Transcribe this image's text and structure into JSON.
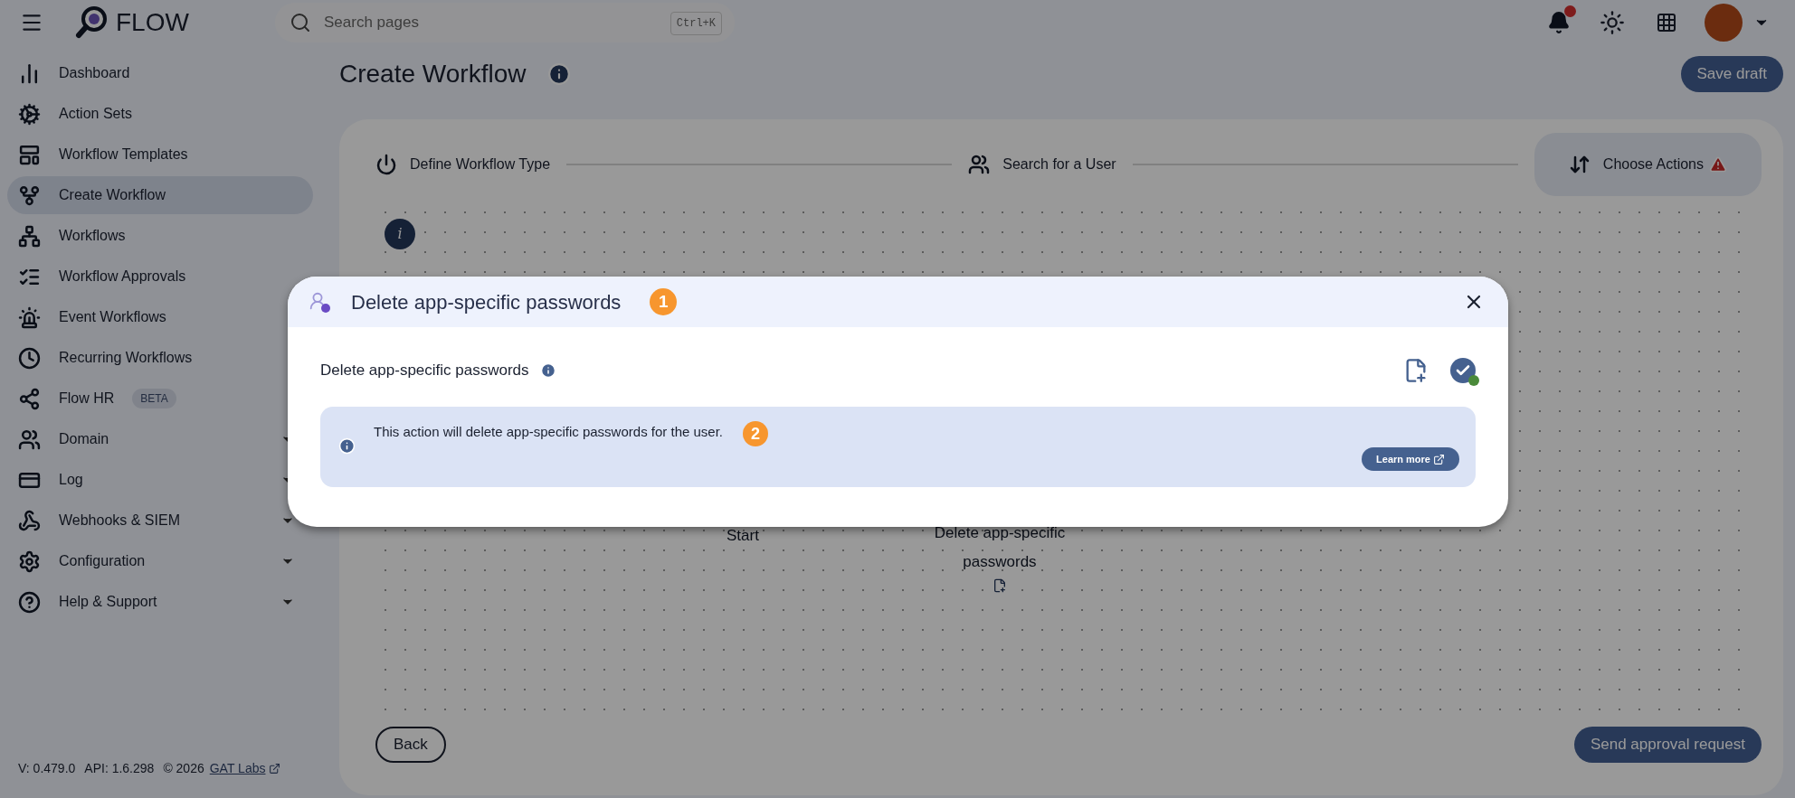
{
  "topbar": {
    "brand": "FLOW",
    "search": {
      "placeholder": "Search pages",
      "shortcut": "Ctrl+K"
    },
    "notifications": {
      "unread": true
    }
  },
  "sidebar": {
    "items": [
      {
        "label": "Dashboard",
        "selected": false,
        "expandable": false
      },
      {
        "label": "Action Sets",
        "selected": false,
        "expandable": false
      },
      {
        "label": "Workflow Templates",
        "selected": false,
        "expandable": false
      },
      {
        "label": "Create Workflow",
        "selected": true,
        "expandable": false
      },
      {
        "label": "Workflows",
        "selected": false,
        "expandable": false
      },
      {
        "label": "Workflow Approvals",
        "selected": false,
        "expandable": false
      },
      {
        "label": "Event Workflows",
        "selected": false,
        "expandable": false
      },
      {
        "label": "Recurring Workflows",
        "selected": false,
        "expandable": false
      },
      {
        "label": "Flow HR",
        "selected": false,
        "expandable": false,
        "badge": "BETA"
      },
      {
        "label": "Domain",
        "selected": false,
        "expandable": true
      },
      {
        "label": "Log",
        "selected": false,
        "expandable": true
      },
      {
        "label": "Webhooks & SIEM",
        "selected": false,
        "expandable": true
      },
      {
        "label": "Configuration",
        "selected": false,
        "expandable": true
      },
      {
        "label": "Help & Support",
        "selected": false,
        "expandable": true
      }
    ],
    "footer": {
      "version": "V: 0.479.0",
      "api": "API: 1.6.298",
      "copyright": "© 2026",
      "link": "GAT Labs"
    }
  },
  "page": {
    "title": "Create Workflow",
    "save_button": "Save draft"
  },
  "stepper": [
    {
      "label": "Define Workflow Type",
      "selected": false,
      "warning": false
    },
    {
      "label": "Search for a User",
      "selected": false,
      "warning": false
    },
    {
      "label": "Choose Actions",
      "selected": true,
      "warning": true
    }
  ],
  "canvas": {
    "nodes": [
      {
        "kind": "info",
        "glyph": "i"
      },
      {
        "kind": "start",
        "label": "Start"
      },
      {
        "kind": "action",
        "label": "Delete app-specific passwords"
      }
    ]
  },
  "buttons": {
    "back": "Back",
    "submit": "Send approval request"
  },
  "modal": {
    "title": "Delete app-specific passwords",
    "marker": "1",
    "heading": "Delete app-specific passwords",
    "completed": true,
    "info": {
      "text": "This action will delete app-specific passwords for the user.",
      "marker": "2",
      "button": "Learn more"
    }
  }
}
